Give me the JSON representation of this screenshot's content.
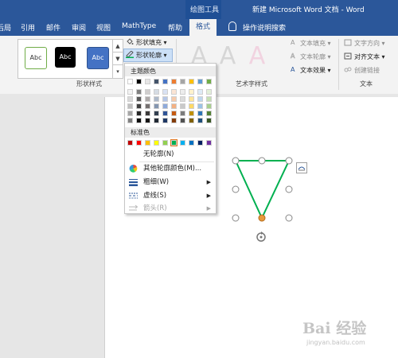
{
  "window": {
    "contextual_tab_group": "绘图工具",
    "doc_title": "新建 Microsoft Word 文档 - Word"
  },
  "tabs": [
    "布局",
    "引用",
    "邮件",
    "审阅",
    "视图",
    "MathType",
    "帮助",
    "格式"
  ],
  "tabs_display": {
    "partial_first": "后局",
    "active": "格式"
  },
  "tell_me": "操作说明搜索",
  "ribbon": {
    "shape_styles": {
      "group_label": "形状样式",
      "gallery": [
        "Abc",
        "Abc",
        "Abc"
      ],
      "shape_fill": "形状填充 ▾",
      "shape_outline": "形状轮廓 ▾"
    },
    "wordart": {
      "group_label": "艺术字样式",
      "letters": [
        "A",
        "A",
        "A"
      ],
      "text_fill": "文本填充 ▾",
      "text_outline": "文本轮廓 ▾",
      "text_effects": "文本效果 ▾"
    },
    "text_group": {
      "group_label": "文本",
      "text_direction": "文字方向 ▾",
      "align_text": "对齐文本 ▾",
      "create_link": "创建链接"
    }
  },
  "outline_dropdown": {
    "theme_colors_label": "主题颜色",
    "standard_colors_label": "标准色",
    "no_outline": "无轮廓(N)",
    "more_colors": "其他轮廓颜色(M)...",
    "weight": "粗细(W)",
    "dashes": "虚线(S)",
    "arrows": "箭头(R)",
    "theme_top_row": [
      "#ffffff",
      "#000000",
      "#e7e6e6",
      "#44546a",
      "#4472c4",
      "#ed7d31",
      "#a5a5a5",
      "#ffc000",
      "#5b9bd5",
      "#70ad47"
    ],
    "theme_shades": [
      [
        "#f2f2f2",
        "#808080",
        "#d0cece",
        "#d6dce4",
        "#d9e2f3",
        "#fbe5d5",
        "#ededed",
        "#fff2cc",
        "#deebf6",
        "#e2efd9"
      ],
      [
        "#d9d9d9",
        "#595959",
        "#aeaaaa",
        "#adb9ca",
        "#b4c6e7",
        "#f7cbac",
        "#dbdbdb",
        "#fee599",
        "#bdd7ee",
        "#c5e0b3"
      ],
      [
        "#bfbfbf",
        "#404040",
        "#757070",
        "#8496b0",
        "#8eaadb",
        "#f4b183",
        "#c9c9c9",
        "#ffd965",
        "#9cc3e5",
        "#a8d08d"
      ],
      [
        "#a6a6a6",
        "#262626",
        "#3a3838",
        "#323f4f",
        "#2f5496",
        "#c55a11",
        "#7b7b7b",
        "#bf9000",
        "#2e75b5",
        "#538135"
      ],
      [
        "#808080",
        "#0d0d0d",
        "#171616",
        "#222a35",
        "#1f3864",
        "#833c0b",
        "#525252",
        "#7f6000",
        "#1e4e79",
        "#375623"
      ]
    ],
    "standard_colors": [
      "#c00000",
      "#ff0000",
      "#ffc000",
      "#ffff00",
      "#92d050",
      "#00b050",
      "#00b0f0",
      "#0070c0",
      "#002060",
      "#7030a0"
    ],
    "selected_standard_index": 5
  },
  "watermark": {
    "text": "Bai 经验",
    "url": "jingyan.baidu.com"
  },
  "colors": {
    "title_bar": "#2b579a",
    "shape_line": "#00b050",
    "handle_accent": "#e79a3c"
  }
}
